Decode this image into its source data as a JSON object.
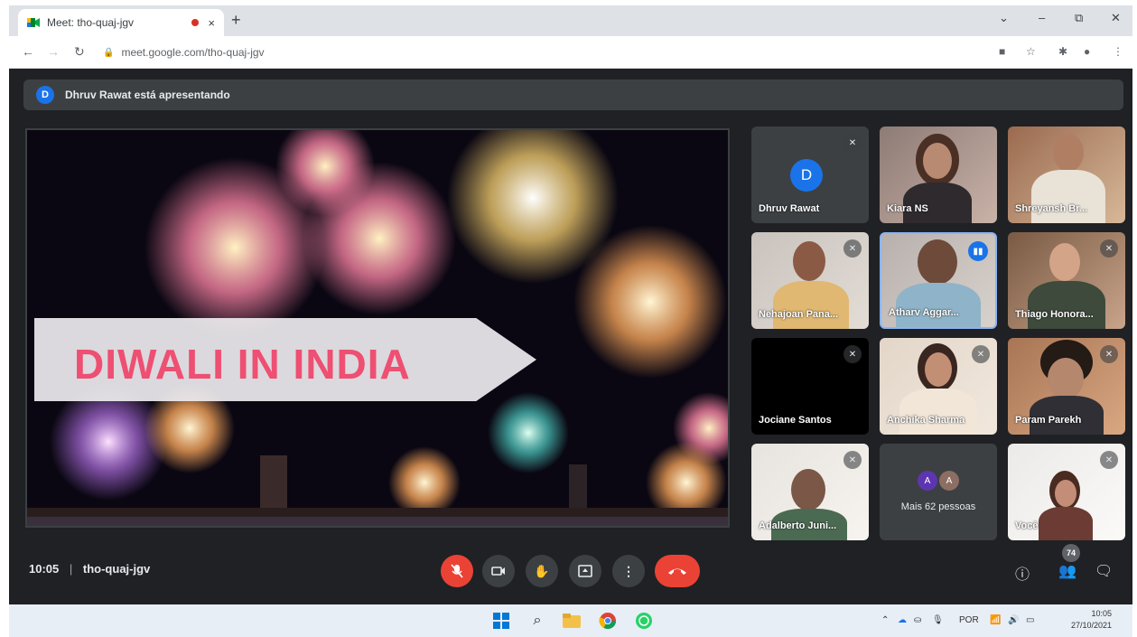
{
  "browser": {
    "tab_title": "Meet: tho-quaj-jgv",
    "tab_close": "×",
    "new_tab": "+",
    "url": "meet.google.com/tho-quaj-jgv",
    "window": {
      "collapse": "⌄",
      "minimize": "–",
      "restore": "⧉",
      "close": "✕"
    }
  },
  "meet": {
    "presenter_initial": "D",
    "presenting_text": "Dhruv Rawat está apresentando",
    "slide_title": "DIWALI IN INDIA",
    "meeting_time": "10:05",
    "meeting_code": "tho-quaj-jgv",
    "participant_count": "74",
    "participants": [
      {
        "name": "Dhruv Rawat",
        "initial": "D",
        "muted": true
      },
      {
        "name": "Kiara NS",
        "muted": false
      },
      {
        "name": "Shreyansh Br...",
        "muted": false
      },
      {
        "name": "Nehajoan Pana...",
        "muted": true
      },
      {
        "name": "Atharv Aggar...",
        "speaking": true
      },
      {
        "name": "Thiago Honora...",
        "muted": true
      },
      {
        "name": "Jociane Santos",
        "muted": true
      },
      {
        "name": "Anchika Sharma",
        "muted": true
      },
      {
        "name": "Param Parekh",
        "muted": true
      },
      {
        "name": "Adalberto Juni...",
        "muted": true
      },
      {
        "name": "Mais 62 pessoas",
        "avatars": [
          "A",
          "A"
        ]
      },
      {
        "name": "Você",
        "muted": true
      }
    ]
  },
  "taskbar": {
    "language": "POR",
    "time": "10:05",
    "date": "27/10/2021"
  },
  "colors": {
    "meet_bg": "#202124",
    "accent": "#1a73e8",
    "danger": "#ea4335",
    "slide_title": "#ee4f72"
  }
}
